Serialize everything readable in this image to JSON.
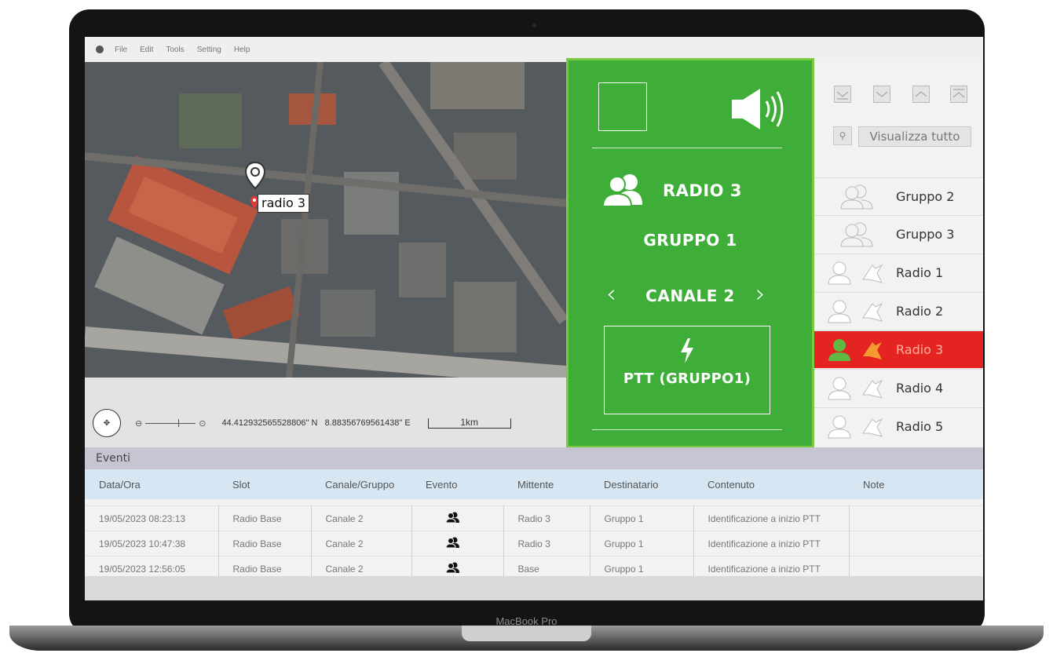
{
  "menu": [
    "File",
    "Edit",
    "Tools",
    "Setting",
    "Help"
  ],
  "map": {
    "marker_label": "radio 3",
    "coordinates": "44.412932565528806\" N   8.88356769561438\" E",
    "scale_label": "1km"
  },
  "control": {
    "radio_name": "RADIO 3",
    "group_name": "GRUPPO 1",
    "channel": "CANALE 2",
    "prev_channel": "‹",
    "next_channel": "›",
    "ptt_label": "PTT (GRUPPO1)"
  },
  "sidebar": {
    "search_label": "Visualizza tutto",
    "items": [
      {
        "label": "Gruppo 2",
        "type": "group"
      },
      {
        "label": "Gruppo 3",
        "type": "group"
      },
      {
        "label": "Radio 1",
        "type": "radio"
      },
      {
        "label": "Radio 2",
        "type": "radio"
      },
      {
        "label": "Radio 3",
        "type": "radio",
        "selected": true
      },
      {
        "label": "Radio 4",
        "type": "radio"
      },
      {
        "label": "Radio 5",
        "type": "radio"
      }
    ]
  },
  "events": {
    "title": "Eventi",
    "columns": [
      "Data/Ora",
      "Slot",
      "Canale/Gruppo",
      "Evento",
      "Mittente",
      "Destinatario",
      "Contenuto",
      "Note"
    ],
    "rows": [
      [
        "19/05/2023 08:23:13",
        "Radio Base",
        "Canale 2",
        "",
        "Radio 3",
        "Gruppo 1",
        "Identificazione a inizio PTT",
        ""
      ],
      [
        "19/05/2023 10:47:38",
        "Radio Base",
        "Canale 2",
        "",
        "Radio 3",
        "Gruppo 1",
        "Identificazione a inizio PTT",
        ""
      ],
      [
        "19/05/2023 12:56:05",
        "Radio Base",
        "Canale 2",
        "",
        "Base",
        "Gruppo 1",
        "Identificazione a inizio PTT",
        ""
      ]
    ]
  },
  "device_label": "MacBook Pro",
  "colors": {
    "panel_green": "#3fae39",
    "selected_red": "#e52421",
    "events_header": "#d6e6f2"
  }
}
